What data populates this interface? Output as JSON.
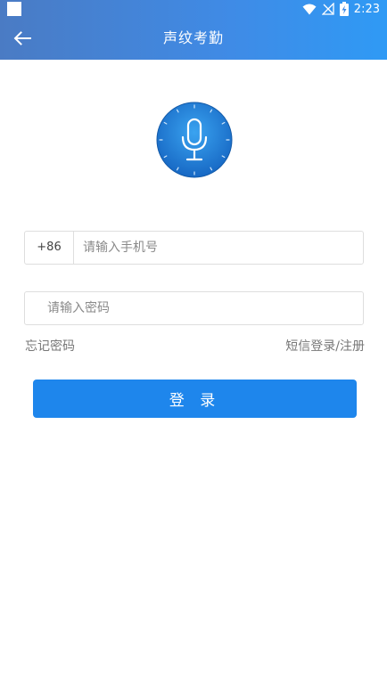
{
  "status_bar": {
    "time": "2:23",
    "icons": [
      "notification-square-icon",
      "wifi-icon",
      "no-signal-icon",
      "battery-charging-icon"
    ]
  },
  "header": {
    "title": "声纹考勤",
    "back_icon": "arrow-left-icon"
  },
  "logo": {
    "icon": "microphone-icon"
  },
  "form": {
    "country_code": "+86",
    "phone_placeholder": "请输入手机号",
    "password_placeholder": "请输入密码",
    "forgot_password": "忘记密码",
    "sms_login_register": "短信登录/注册",
    "login_button": "登 录"
  },
  "colors": {
    "header_start": "#4a7bc4",
    "header_end": "#2f9af5",
    "primary_button": "#1e86ec",
    "logo_blue": "#1f7fd6"
  }
}
